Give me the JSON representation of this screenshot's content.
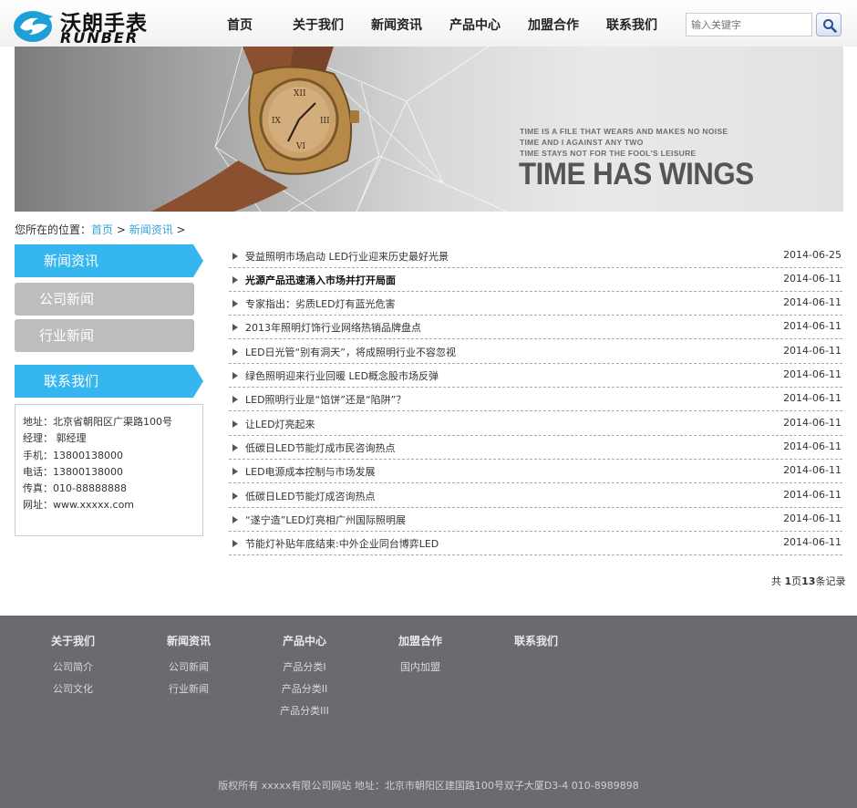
{
  "header": {
    "logo_cn": "沃朗手表",
    "logo_en": "RUNBER",
    "nav": [
      "首页",
      "关于我们",
      "新闻资讯",
      "产品中心",
      "加盟合作",
      "联系我们"
    ],
    "search_placeholder": "输入关键字"
  },
  "banner": {
    "lines": [
      "TIME IS A FILE THAT WEARS AND MAKES NO NOISE",
      "TIME AND I AGAINST ANY TWO",
      "TIME STAYS NOT FOR THE FOOL'S LEISURE"
    ],
    "headline": "TIME HAS WINGS"
  },
  "breadcrumb": {
    "prefix": "您所在的位置：",
    "home": "首页",
    "sep1": " > ",
    "current": "新闻资讯",
    "sep2": " >"
  },
  "sidebar": {
    "news_head": "新闻资讯",
    "tabs": [
      "公司新闻",
      "行业新闻"
    ],
    "contact_head": "联系我们",
    "contact_lines": [
      "地址：北京省朝阳区广渠路100号",
      "经理： 郭经理",
      "手机：13800138000",
      "电话：13800138000",
      "传真：010-88888888",
      "网址：www.xxxxx.com"
    ]
  },
  "news": [
    {
      "title": "受益照明市场启动 LED行业迎来历史最好光景",
      "date": "2014-06-25",
      "bold": false
    },
    {
      "title": "光源产品迅速涌入市场并打开局面",
      "date": "2014-06-11",
      "bold": true
    },
    {
      "title": "专家指出：劣质LED灯有蓝光危害",
      "date": "2014-06-11",
      "bold": false
    },
    {
      "title": "2013年照明灯饰行业网络热销品牌盘点",
      "date": "2014-06-11",
      "bold": false
    },
    {
      "title": "LED日光管“别有洞天”，将成照明行业不容忽视",
      "date": "2014-06-11",
      "bold": false
    },
    {
      "title": "绿色照明迎来行业回暖 LED概念股市场反弹",
      "date": "2014-06-11",
      "bold": false
    },
    {
      "title": "LED照明行业是“馅饼”还是“陷阱”？",
      "date": "2014-06-11",
      "bold": false
    },
    {
      "title": "让LED灯亮起来",
      "date": "2014-06-11",
      "bold": false
    },
    {
      "title": "低碳日LED节能灯成市民咨询热点",
      "date": "2014-06-11",
      "bold": false
    },
    {
      "title": "LED电源成本控制与市场发展",
      "date": "2014-06-11",
      "bold": false
    },
    {
      "title": "低碳日LED节能灯成咨询热点",
      "date": "2014-06-11",
      "bold": false
    },
    {
      "title": "“遂宁造”LED灯亮相广州国际照明展",
      "date": "2014-06-11",
      "bold": false
    },
    {
      "title": "节能灯补贴年底结束:中外企业同台博弈LED",
      "date": "2014-06-11",
      "bold": false
    }
  ],
  "pager": {
    "pre": "共 ",
    "pages": "1",
    "mid": "页",
    "records": "13",
    "post": "条记录"
  },
  "footer": {
    "columns": [
      {
        "head": "关于我们",
        "links": [
          "公司简介",
          "公司文化"
        ]
      },
      {
        "head": "新闻资讯",
        "links": [
          "公司新闻",
          "行业新闻"
        ]
      },
      {
        "head": "产品中心",
        "links": [
          "产品分类I",
          "产品分类II",
          "产品分类III"
        ]
      },
      {
        "head": "加盟合作",
        "links": [
          "国内加盟"
        ]
      },
      {
        "head": "联系我们",
        "links": []
      }
    ],
    "copyright": "版权所有 xxxxx有限公司网站 地址：北京市朝阳区建国路100号双子大厦D3-4 010-8989898"
  },
  "colors": {
    "accent": "#35b6ef",
    "tab_gray": "#bdbdbd",
    "footer_bg": "#6a6b70"
  }
}
